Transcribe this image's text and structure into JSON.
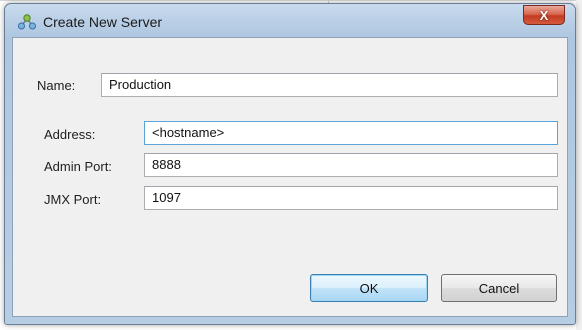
{
  "window": {
    "title": "Create New Server",
    "close_glyph": "X"
  },
  "form": {
    "name": {
      "label": "Name:",
      "value": "Production"
    },
    "address": {
      "label": "Address:",
      "value": "<hostname>"
    },
    "admin_port": {
      "label": "Admin Port:",
      "value": "8888"
    },
    "jmx_port": {
      "label": "JMX Port:",
      "value": "1097"
    }
  },
  "buttons": {
    "ok": "OK",
    "cancel": "Cancel"
  },
  "icons": {
    "title_icon": "server-network-icon",
    "close_icon": "close-icon"
  },
  "colors": {
    "titlebar": "#b9cfe6",
    "client_bg": "#f0f0f0",
    "close_button": "#c23c22",
    "focus_border": "#5aa4d8",
    "default_button": "#c1e3f9"
  }
}
